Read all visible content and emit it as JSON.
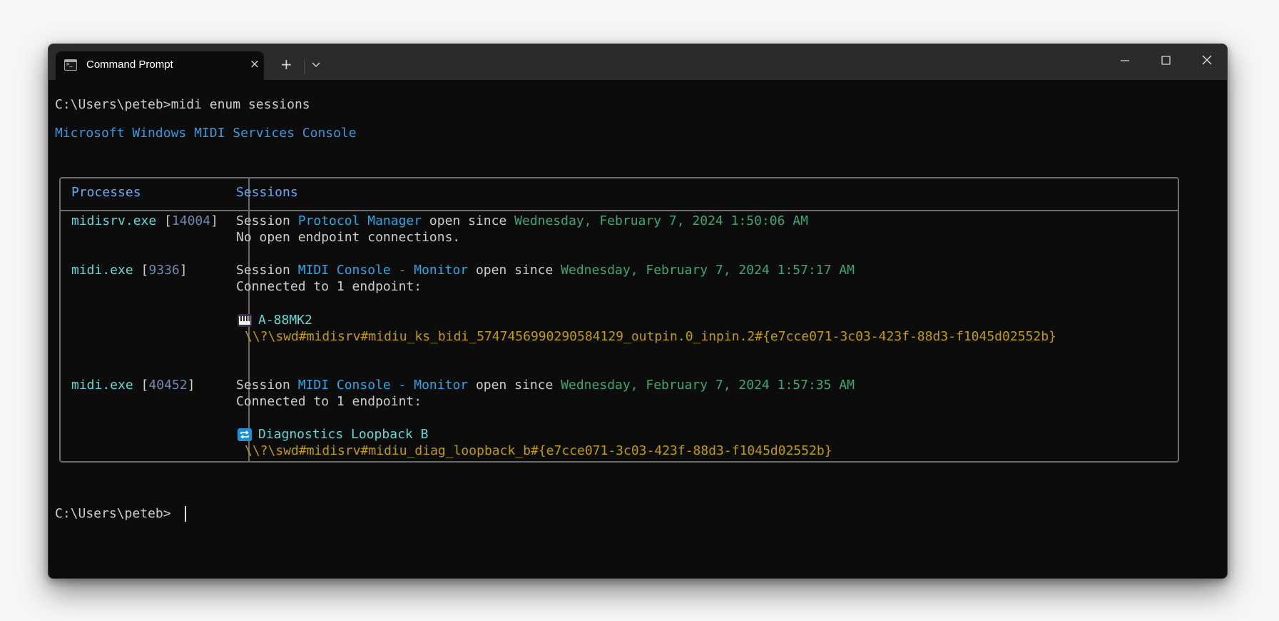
{
  "window": {
    "tab_title": "Command Prompt",
    "tab_icon": "terminal-icon",
    "new_tab_icon": "plus-icon",
    "dropdown_icon": "chevron-down-icon",
    "minimize_icon": "minimize-icon",
    "maximize_icon": "maximize-icon",
    "close_icon": "close-icon",
    "tab_close_glyph": "×",
    "new_tab_glyph": "+"
  },
  "terminal": {
    "prompt": "C:\\Users\\peteb>",
    "command": "midi enum sessions",
    "banner": "Microsoft Windows MIDI Services Console",
    "final_prompt": "C:\\Users\\peteb>"
  },
  "table": {
    "headers": {
      "processes": "Processes",
      "sessions": "Sessions"
    },
    "common": {
      "session_word": "Session ",
      "open_since": " open since ",
      "bracket_open": " [",
      "bracket_close": "]"
    },
    "rows": [
      {
        "process": "midisrv.exe",
        "pid": "14004",
        "session_name": "Protocol Manager",
        "since": "Wednesday, February 7, 2024 1:50:06 AM",
        "connection_text": "No open endpoint connections."
      },
      {
        "process": "midi.exe",
        "pid": "9336",
        "session_name": "MIDI Console - Monitor",
        "since": "Wednesday, February 7, 2024 1:57:17 AM",
        "connection_text": "Connected to 1 endpoint:",
        "endpoint_icon": "piano-keyboard-icon",
        "endpoint_name": "A-88MK2",
        "endpoint_path": "\\\\?\\swd#midisrv#midiu_ks_bidi_5747456990290584129_outpin.0_inpin.2#{e7cce071-3c03-423f-88d3-f1045d02552b}"
      },
      {
        "process": "midi.exe",
        "pid": "40452",
        "session_name": "MIDI Console - Monitor",
        "since": "Wednesday, February 7, 2024 1:57:35 AM",
        "connection_text": "Connected to 1 endpoint:",
        "endpoint_icon": "loopback-icon",
        "endpoint_name": "Diagnostics Loopback B",
        "endpoint_path": "\\\\?\\swd#midisrv#midiu_diag_loopback_b#{e7cce071-3c03-423f-88d3-f1045d02552b}"
      }
    ]
  }
}
